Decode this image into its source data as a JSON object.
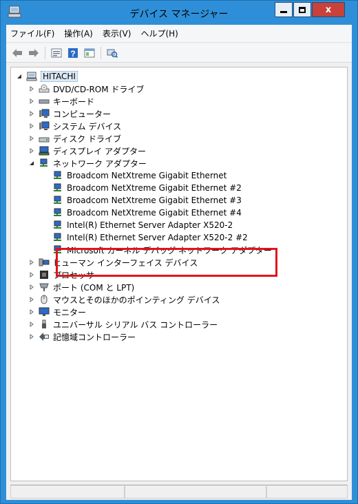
{
  "window": {
    "title": "デバイス マネージャー",
    "close_glyph": "x"
  },
  "menu": [
    "ファイル(F)",
    "操作(A)",
    "表示(V)",
    "ヘルプ(H)"
  ],
  "toolbar": {
    "icons": [
      "back-icon",
      "forward-icon",
      "properties-icon",
      "help-icon",
      "view-icon",
      "scan-hardware-icon"
    ]
  },
  "tree": {
    "root": "HITACHI",
    "categories": [
      "DVD/CD-ROM ドライブ",
      "キーボード",
      "コンピューター",
      "システム デバイス",
      "ディスク ドライブ",
      "ディスプレイ アダプター",
      "ネットワーク アダプター"
    ],
    "network_adapters": [
      "Broadcom NetXtreme Gigabit Ethernet",
      "Broadcom NetXtreme Gigabit Ethernet #2",
      "Broadcom NetXtreme Gigabit Ethernet #3",
      "Broadcom NetXtreme Gigabit Ethernet #4",
      "Intel(R) Ethernet Server Adapter X520-2",
      "Intel(R) Ethernet Server Adapter X520-2 #2",
      "Microsoft カーネル デバッグ ネットワーク アダプター"
    ],
    "categories_after": [
      "ヒューマン インターフェイス デバイス",
      "プロセッサ",
      "ポート (COM と LPT)",
      "マウスとそのほかのポインティング デバイス",
      "モニター",
      "ユニバーサル シリアル バス コントローラー",
      "記憶域コントローラー"
    ]
  },
  "colors": {
    "titlebar": "#2e8fd8",
    "highlight": "#e0141c",
    "close_button": "#c8413a"
  }
}
